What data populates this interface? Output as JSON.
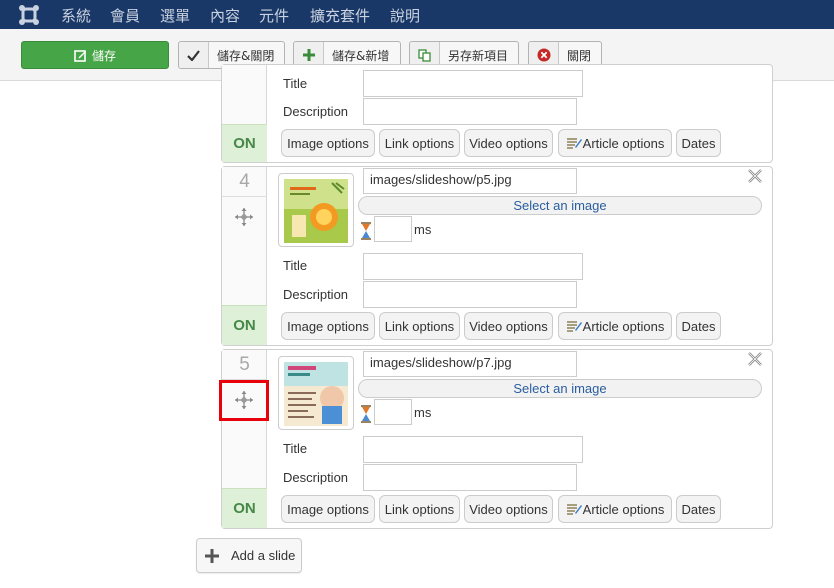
{
  "menu": {
    "items": [
      "系統",
      "會員",
      "選單",
      "內容",
      "元件",
      "擴充套件",
      "說明"
    ]
  },
  "toolbar": {
    "save": "儲存",
    "save_close": "儲存&關閉",
    "save_new": "儲存&新增",
    "save_copy": "另存新項目",
    "close": "關閉"
  },
  "slides": [
    {
      "status": "ON",
      "title_label": "Title",
      "description_label": "Description",
      "options": [
        "Image options",
        "Link options",
        "Video options",
        "Article options",
        "Dates"
      ]
    },
    {
      "number": "4",
      "image_path": "images/slideshow/p5.jpg",
      "select_image": "Select an image",
      "ms_label": "ms",
      "title_label": "Title",
      "description_label": "Description",
      "status": "ON",
      "options": [
        "Image options",
        "Link options",
        "Video options",
        "Article options",
        "Dates"
      ]
    },
    {
      "number": "5",
      "image_path": "images/slideshow/p7.jpg",
      "select_image": "Select an image",
      "ms_label": "ms",
      "title_label": "Title",
      "description_label": "Description",
      "status": "ON",
      "options": [
        "Image options",
        "Link options",
        "Video options",
        "Article options",
        "Dates"
      ]
    }
  ],
  "add_slide": "Add a slide",
  "colors": {
    "menubar": "#1a3867",
    "save_green": "#46a546",
    "on_green": "#468847",
    "highlight_red": "#e8000b",
    "link_blue": "#2a5d9f"
  }
}
